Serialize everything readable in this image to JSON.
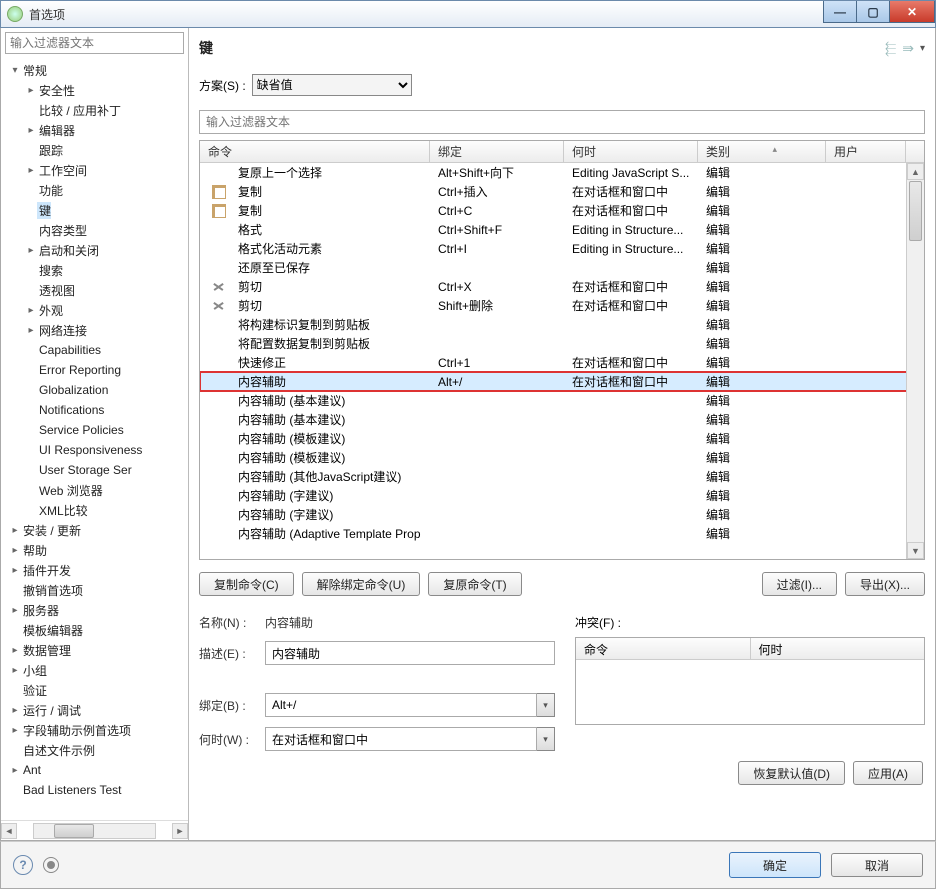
{
  "window": {
    "title": "首选项"
  },
  "sidebar": {
    "filter_placeholder": "输入过滤器文本",
    "nodes": [
      {
        "label": "常规",
        "indent": 0,
        "exp": "▾"
      },
      {
        "label": "安全性",
        "indent": 1,
        "exp": "▸"
      },
      {
        "label": "比较 / 应用补丁",
        "indent": 1,
        "exp": ""
      },
      {
        "label": "编辑器",
        "indent": 1,
        "exp": "▸"
      },
      {
        "label": "跟踪",
        "indent": 1,
        "exp": ""
      },
      {
        "label": "工作空间",
        "indent": 1,
        "exp": "▸"
      },
      {
        "label": "功能",
        "indent": 1,
        "exp": ""
      },
      {
        "label": "键",
        "indent": 1,
        "exp": "",
        "selected": true
      },
      {
        "label": "内容类型",
        "indent": 1,
        "exp": ""
      },
      {
        "label": "启动和关闭",
        "indent": 1,
        "exp": "▸"
      },
      {
        "label": "搜索",
        "indent": 1,
        "exp": ""
      },
      {
        "label": "透视图",
        "indent": 1,
        "exp": ""
      },
      {
        "label": "外观",
        "indent": 1,
        "exp": "▸"
      },
      {
        "label": "网络连接",
        "indent": 1,
        "exp": "▸"
      },
      {
        "label": "Capabilities",
        "indent": 1,
        "exp": ""
      },
      {
        "label": "Error Reporting",
        "indent": 1,
        "exp": ""
      },
      {
        "label": "Globalization",
        "indent": 1,
        "exp": ""
      },
      {
        "label": "Notifications",
        "indent": 1,
        "exp": ""
      },
      {
        "label": "Service Policies",
        "indent": 1,
        "exp": ""
      },
      {
        "label": "UI Responsiveness",
        "indent": 1,
        "exp": ""
      },
      {
        "label": "User Storage Ser",
        "indent": 1,
        "exp": ""
      },
      {
        "label": "Web 浏览器",
        "indent": 1,
        "exp": ""
      },
      {
        "label": "XML比较",
        "indent": 1,
        "exp": ""
      },
      {
        "label": "安装 / 更新",
        "indent": 0,
        "exp": "▸"
      },
      {
        "label": "帮助",
        "indent": 0,
        "exp": "▸"
      },
      {
        "label": "插件开发",
        "indent": 0,
        "exp": "▸"
      },
      {
        "label": "撤销首选项",
        "indent": 0,
        "exp": ""
      },
      {
        "label": "服务器",
        "indent": 0,
        "exp": "▸"
      },
      {
        "label": "模板编辑器",
        "indent": 0,
        "exp": ""
      },
      {
        "label": "数据管理",
        "indent": 0,
        "exp": "▸"
      },
      {
        "label": "小组",
        "indent": 0,
        "exp": "▸"
      },
      {
        "label": "验证",
        "indent": 0,
        "exp": ""
      },
      {
        "label": "运行 / 调试",
        "indent": 0,
        "exp": "▸"
      },
      {
        "label": "字段辅助示例首选项",
        "indent": 0,
        "exp": "▸"
      },
      {
        "label": "自述文件示例",
        "indent": 0,
        "exp": ""
      },
      {
        "label": "Ant",
        "indent": 0,
        "exp": "▸"
      },
      {
        "label": "Bad Listeners Test",
        "indent": 0,
        "exp": ""
      }
    ]
  },
  "page": {
    "title": "键",
    "scheme_label": "方案(S) :",
    "scheme_value": "缺省值",
    "filter_placeholder": "输入过滤器文本",
    "columns": {
      "cmd": "命令",
      "bnd": "绑定",
      "whn": "何时",
      "cat": "类别",
      "usr": "用户"
    },
    "rows": [
      {
        "icon": "",
        "cmd": "复原上一个选择",
        "bnd": "Alt+Shift+向下",
        "whn": "Editing JavaScript S...",
        "cat": "编辑"
      },
      {
        "icon": "copy",
        "cmd": "复制",
        "bnd": "Ctrl+插入",
        "whn": "在对话框和窗口中",
        "cat": "编辑"
      },
      {
        "icon": "copy",
        "cmd": "复制",
        "bnd": "Ctrl+C",
        "whn": "在对话框和窗口中",
        "cat": "编辑"
      },
      {
        "icon": "",
        "cmd": "格式",
        "bnd": "Ctrl+Shift+F",
        "whn": "Editing in Structure...",
        "cat": "编辑"
      },
      {
        "icon": "",
        "cmd": "格式化活动元素",
        "bnd": "Ctrl+I",
        "whn": "Editing in Structure...",
        "cat": "编辑"
      },
      {
        "icon": "",
        "cmd": "还原至已保存",
        "bnd": "",
        "whn": "",
        "cat": "编辑"
      },
      {
        "icon": "cut",
        "cmd": "剪切",
        "bnd": "Ctrl+X",
        "whn": "在对话框和窗口中",
        "cat": "编辑"
      },
      {
        "icon": "cut",
        "cmd": "剪切",
        "bnd": "Shift+删除",
        "whn": "在对话框和窗口中",
        "cat": "编辑"
      },
      {
        "icon": "",
        "cmd": "将构建标识复制到剪贴板",
        "bnd": "",
        "whn": "",
        "cat": "编辑"
      },
      {
        "icon": "",
        "cmd": "将配置数据复制到剪贴板",
        "bnd": "",
        "whn": "",
        "cat": "编辑"
      },
      {
        "icon": "",
        "cmd": "快速修正",
        "bnd": "Ctrl+1",
        "whn": "在对话框和窗口中",
        "cat": "编辑"
      },
      {
        "icon": "",
        "cmd": "内容辅助",
        "bnd": "Alt+/",
        "whn": "在对话框和窗口中",
        "cat": "编辑",
        "highlight": true
      },
      {
        "icon": "",
        "cmd": "内容辅助 (基本建议)",
        "bnd": "",
        "whn": "",
        "cat": "编辑"
      },
      {
        "icon": "",
        "cmd": "内容辅助 (基本建议)",
        "bnd": "",
        "whn": "",
        "cat": "编辑"
      },
      {
        "icon": "",
        "cmd": "内容辅助 (模板建议)",
        "bnd": "",
        "whn": "",
        "cat": "编辑"
      },
      {
        "icon": "",
        "cmd": "内容辅助 (模板建议)",
        "bnd": "",
        "whn": "",
        "cat": "编辑"
      },
      {
        "icon": "",
        "cmd": "内容辅助 (其他JavaScript建议)",
        "bnd": "",
        "whn": "",
        "cat": "编辑"
      },
      {
        "icon": "",
        "cmd": "内容辅助 (字建议)",
        "bnd": "",
        "whn": "",
        "cat": "编辑"
      },
      {
        "icon": "",
        "cmd": "内容辅助 (字建议)",
        "bnd": "",
        "whn": "",
        "cat": "编辑"
      },
      {
        "icon": "",
        "cmd": "内容辅助 (Adaptive Template Prop",
        "bnd": "",
        "whn": "",
        "cat": "编辑"
      }
    ],
    "buttons": {
      "copy": "复制命令(C)",
      "unbind": "解除绑定命令(U)",
      "restore": "复原命令(T)",
      "filter": "过滤(I)...",
      "export": "导出(X)..."
    },
    "detail": {
      "name_label": "名称(N) :",
      "name_value": "内容辅助",
      "desc_label": "描述(E) :",
      "desc_value": "内容辅助",
      "bind_label": "绑定(B) :",
      "bind_value": "Alt+/",
      "when_label": "何时(W) :",
      "when_value": "在对话框和窗口中",
      "conflict_label": "冲突(F) :",
      "conf_cols": {
        "cmd": "命令",
        "when": "何时"
      }
    },
    "restore_defaults": "恢复默认值(D)",
    "apply": "应用(A)"
  },
  "bottom": {
    "ok": "确定",
    "cancel": "取消"
  }
}
